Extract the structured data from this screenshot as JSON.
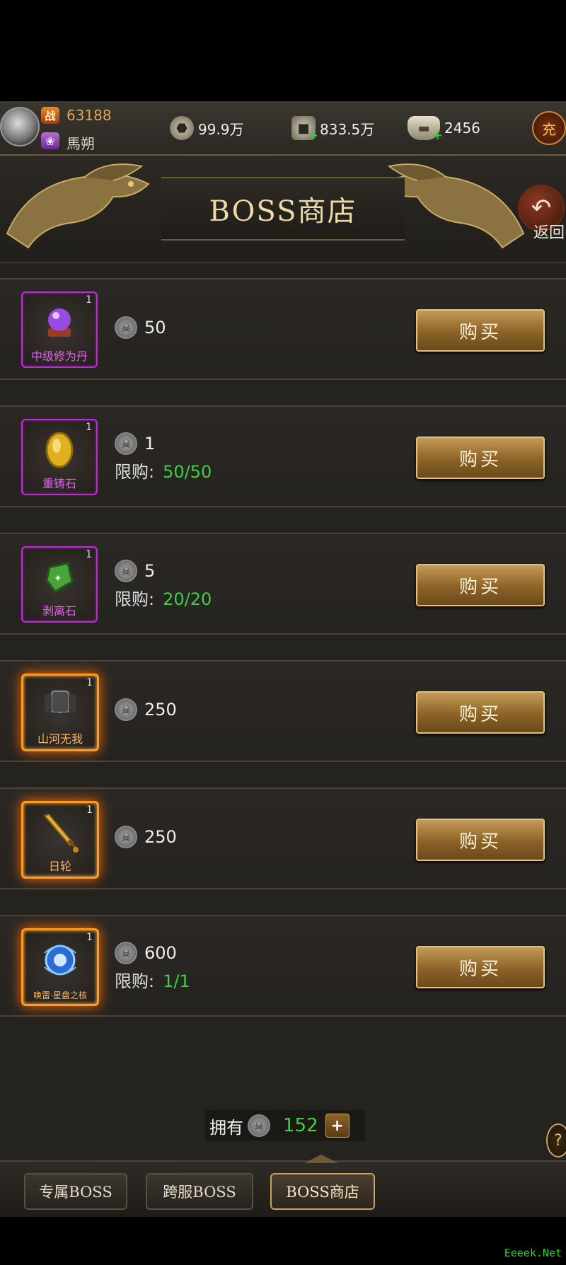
{
  "topbar": {
    "power_icon": "战",
    "combat_power": "63188",
    "vip_icon": "lotus-icon",
    "player_name": "馬朔",
    "resources": [
      {
        "icon": "stamina-icon",
        "value": "99.9万"
      },
      {
        "icon": "copper-coin-icon",
        "value": "833.5万"
      },
      {
        "icon": "gold-ingot-icon",
        "value": "2456"
      }
    ],
    "recharge_label": "充"
  },
  "banner": {
    "title": "BOSS商店",
    "back_label": "返回"
  },
  "items": [
    {
      "name": "中级修为丹",
      "price": "50",
      "limit_label": "",
      "limit_value": "",
      "corner": "1",
      "rarity": "purple"
    },
    {
      "name": "重铸石",
      "price": "1",
      "limit_label": "限购:",
      "limit_value": "50/50",
      "corner": "1",
      "rarity": "purple"
    },
    {
      "name": "剥离石",
      "price": "5",
      "limit_label": "限购:",
      "limit_value": "20/20",
      "corner": "1",
      "rarity": "purple"
    },
    {
      "name": "山河无我",
      "price": "250",
      "limit_label": "",
      "limit_value": "",
      "corner": "1",
      "rarity": "orange"
    },
    {
      "name": "日轮",
      "price": "250",
      "limit_label": "",
      "limit_value": "",
      "corner": "1",
      "rarity": "orange"
    },
    {
      "name": "唤雷·星盘之核",
      "price": "600",
      "limit_label": "限购:",
      "limit_value": "1/1",
      "corner": "1",
      "rarity": "orange"
    }
  ],
  "buy_label": "购买",
  "owned": {
    "label": "拥有",
    "value": "152",
    "add_label": "+"
  },
  "help_label": "?",
  "tabs": [
    {
      "label": "专属BOSS",
      "active": false
    },
    {
      "label": "跨服BOSS",
      "active": false
    },
    {
      "label": "BOSS商店",
      "active": true
    }
  ],
  "watermark": "Eeeek.Net",
  "colors": {
    "accent_gold": "#c59a57",
    "limit_green": "#3fcf3f",
    "rarity_purple": "#c02bd6",
    "rarity_orange": "#ff9a1e"
  }
}
